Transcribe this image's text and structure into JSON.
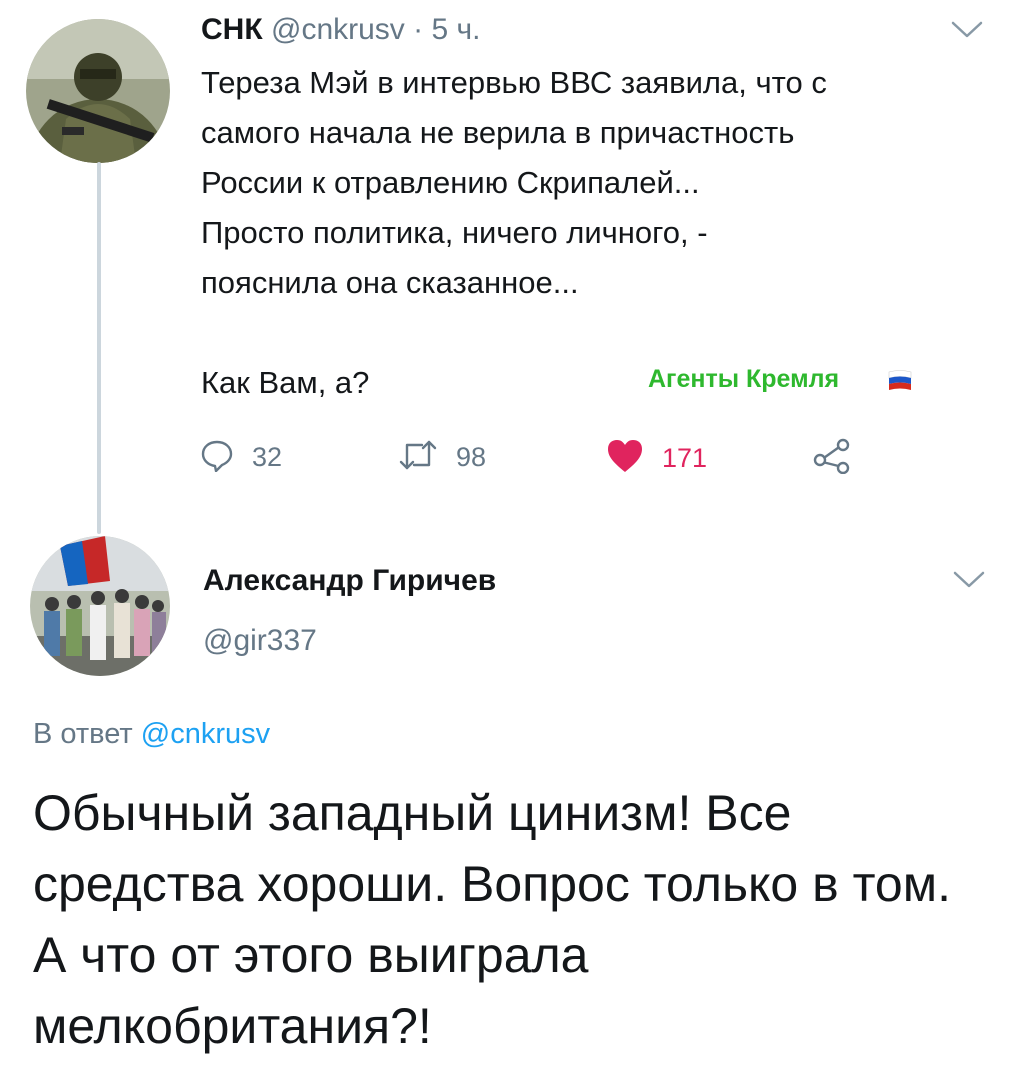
{
  "tweet1": {
    "name": "СНК",
    "handle": "@cnkrusv",
    "separator": "·",
    "time": "5 ч.",
    "body_lines": [
      "Тереза Мэй в интервью ВВС заявила, что с",
      "самого начала не верила в причастность",
      "России к отравлению Скрипалей...",
      "Просто политика, ничего личного, -",
      "пояснила она сказанное..."
    ],
    "closing_line": "Как Вам, а?",
    "watermark": "Агенты Кремля",
    "actions": {
      "replies": "32",
      "retweets": "98",
      "likes": "171"
    }
  },
  "tweet2": {
    "name": "Александр Гиричев",
    "handle": "@gir337",
    "replying_prefix": "В ответ",
    "replying_to": "@cnkrusv",
    "body": "Обычный западный цинизм! Все средства хороши. Вопрос только в том. А что от этого выиграла мелкобритания?!"
  },
  "colors": {
    "text": "#14171a",
    "secondary": "#657786",
    "link": "#1da1f2",
    "like": "#e0245e",
    "watermark": "#2eb82e",
    "thread_line": "#ccd6dd"
  },
  "icons": {
    "reply": "speech-bubble-icon",
    "retweet": "retweet-icon",
    "like": "heart-filled-icon",
    "share": "share-icon",
    "menu": "chevron-down-icon",
    "flag": "russian-flag-icon"
  }
}
